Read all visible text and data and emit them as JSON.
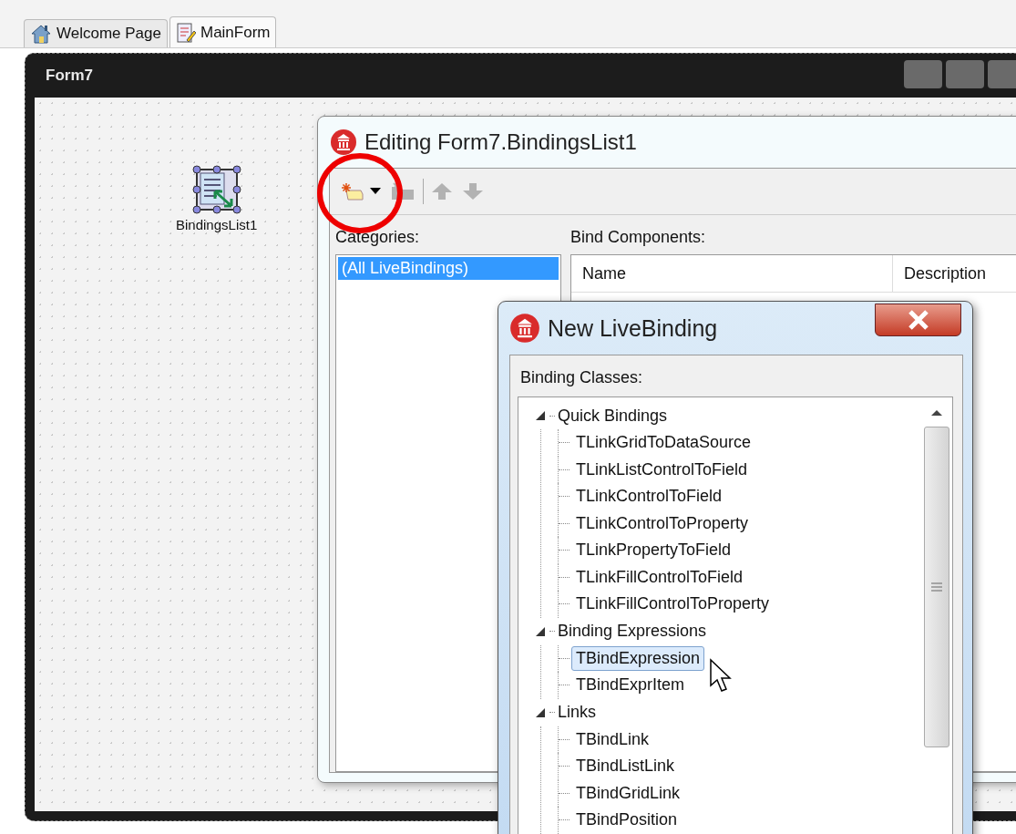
{
  "tabs": [
    {
      "label": "Welcome Page",
      "kind": "home",
      "selected": false
    },
    {
      "label": "MainForm",
      "kind": "form",
      "selected": true
    }
  ],
  "form": {
    "title": "Form7",
    "component": {
      "label": "BindingsList1"
    }
  },
  "editor": {
    "title": "Editing Form7.BindingsList1",
    "toolbar": [
      {
        "kind": "new",
        "disabled": false
      },
      {
        "kind": "delete",
        "disabled": true
      },
      {
        "kind": "up",
        "disabled": true
      },
      {
        "kind": "down",
        "disabled": true
      }
    ],
    "categories_label": "Categories:",
    "categories": [
      {
        "label": "(All LiveBindings)",
        "selected": true
      }
    ],
    "components_label": "Bind Components:",
    "columns": [
      "Name",
      "Description"
    ]
  },
  "dialog": {
    "title": "New LiveBinding",
    "classes_label": "Binding Classes:",
    "tree": [
      {
        "label": "Quick Bindings",
        "expanded": true,
        "children": [
          {
            "label": "TLinkGridToDataSource",
            "selected": false
          },
          {
            "label": "TLinkListControlToField",
            "selected": false
          },
          {
            "label": "TLinkControlToField",
            "selected": false
          },
          {
            "label": "TLinkControlToProperty",
            "selected": false
          },
          {
            "label": "TLinkPropertyToField",
            "selected": false
          },
          {
            "label": "TLinkFillControlToField",
            "selected": false
          },
          {
            "label": "TLinkFillControlToProperty",
            "selected": false
          }
        ]
      },
      {
        "label": "Binding Expressions",
        "expanded": true,
        "children": [
          {
            "label": "TBindExpression",
            "selected": true
          },
          {
            "label": "TBindExprItem",
            "selected": false
          }
        ]
      },
      {
        "label": "Links",
        "expanded": true,
        "children": [
          {
            "label": "TBindLink",
            "selected": false
          },
          {
            "label": "TBindListLink",
            "selected": false
          },
          {
            "label": "TBindGridLink",
            "selected": false
          },
          {
            "label": "TBindPosition",
            "selected": false
          }
        ]
      }
    ]
  }
}
